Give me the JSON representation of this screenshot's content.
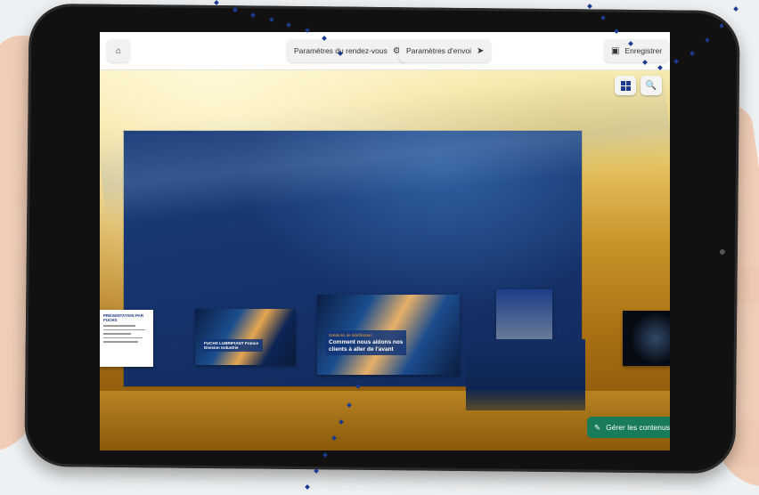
{
  "toolbar": {
    "home_icon": "home-icon",
    "rdv_label": "Paramètres du rendez-vous",
    "rdv_icon": "gear-icon",
    "envoi_label": "Paramètres d'envoi",
    "envoi_icon": "paper-plane-icon",
    "save_label": "Enregistrer",
    "save_icon": "floppy-disk-icon"
  },
  "scene": {
    "grid_icon": "grid-icon",
    "search_icon": "search-icon",
    "manage_label": "Gérer les contenus",
    "manage_icon": "edit-icon"
  },
  "posters": {
    "doc_title": "PRÉSENTATION PAR FUCHS",
    "poster1_label": "FUCHS LUBRIFIANT France Division Industrie",
    "poster2_kicker": "Solutions de lubrification",
    "poster2_label": "Comment nous aidons nos clients à aller de l'avant"
  },
  "colors": {
    "accent": "#1a7b58",
    "wall": "#173671"
  }
}
